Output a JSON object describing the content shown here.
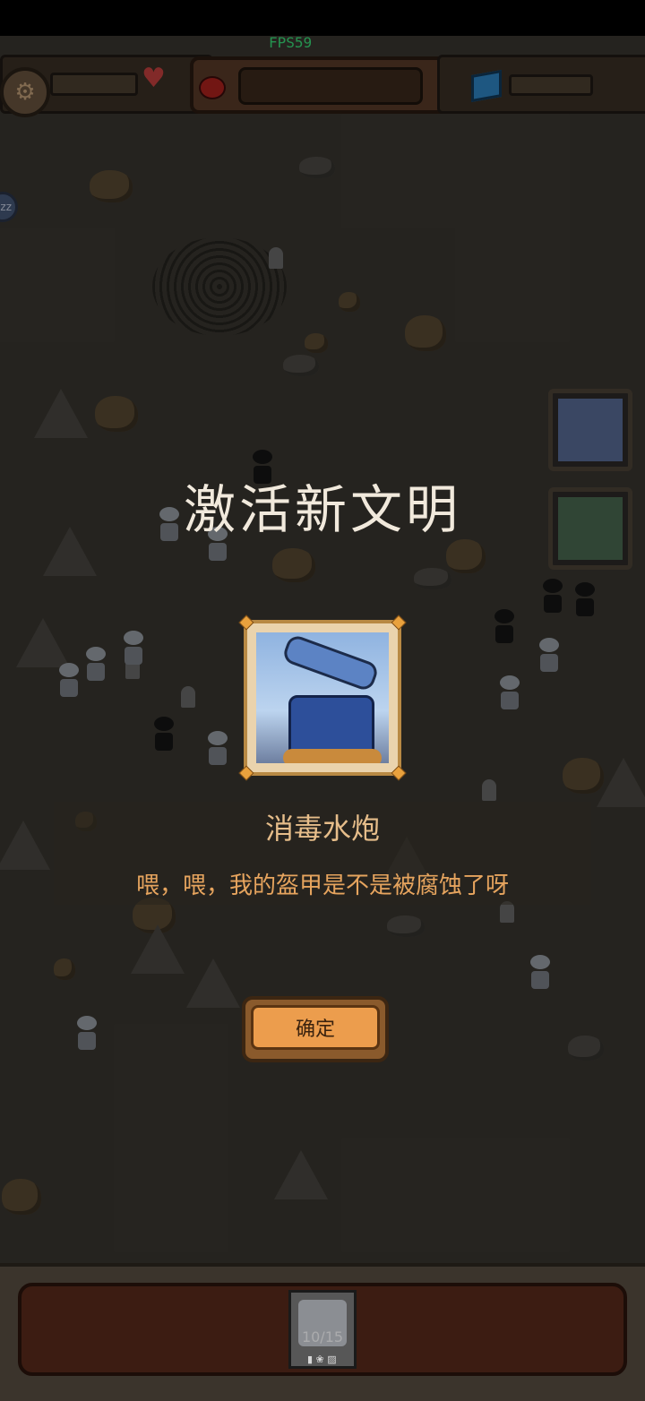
{
  "hud": {
    "fps_label": "FPS59"
  },
  "popup": {
    "title": "激活新文明",
    "unit_name": "消毒水炮",
    "unit_description": "喂，喂，我的盔甲是不是被腐蚀了呀",
    "confirm_label": "确定"
  },
  "side_panel": {
    "sleep_label": "zz"
  },
  "bottom_bar": {
    "slot_count": "10/15"
  },
  "icons": [
    "gear-icon",
    "heart-icon",
    "gem-icon",
    "cube-icon"
  ],
  "colors": {
    "fps": "#39e07a",
    "title": "#f1e9dc",
    "unit_name": "#e6bd8a",
    "description": "#e6a45e",
    "confirm_button": "#ec9d4d"
  }
}
